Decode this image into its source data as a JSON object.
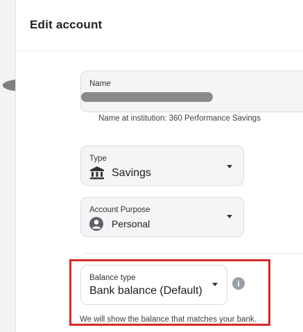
{
  "header": {
    "title": "Edit account"
  },
  "name_field": {
    "label": "Name",
    "value_redacted": true,
    "helper": "Name at institution: 360 Performance Savings"
  },
  "type_field": {
    "label": "Type",
    "value": "Savings",
    "icon": "bank-icon"
  },
  "purpose_field": {
    "label": "Account Purpose",
    "value": "Personal",
    "icon": "person-icon"
  },
  "balance_field": {
    "label": "Balance type",
    "value": "Bank balance (Default)",
    "helper": "We will show the balance that matches your bank.",
    "info_glyph": "i"
  },
  "colors": {
    "highlight": "#d62828",
    "redaction": "#8a8a8a"
  }
}
